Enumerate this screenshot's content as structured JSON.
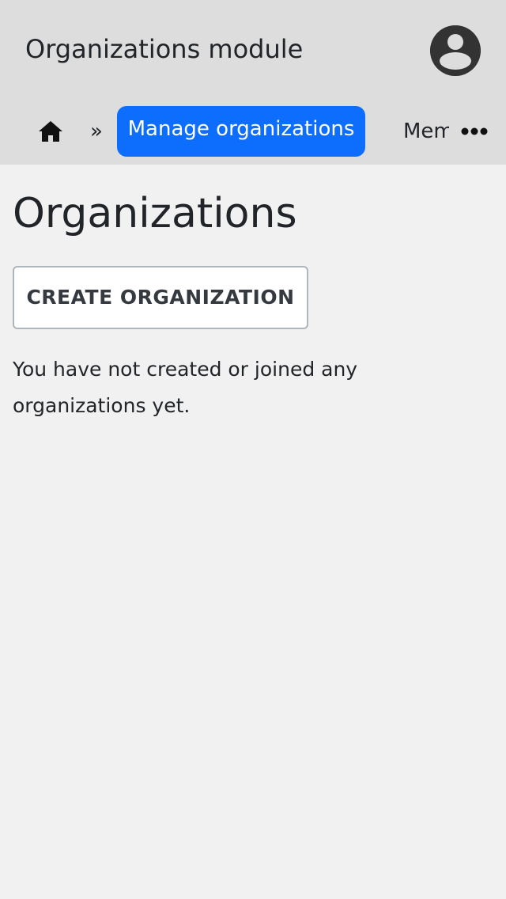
{
  "header": {
    "title": "Organizations module",
    "avatar_icon": "user-circle-icon"
  },
  "breadcrumb": {
    "home_icon": "home-icon",
    "separator": "»",
    "active_label": "Manage organizations",
    "next_label": "Members",
    "more_icon": "ellipsis-icon"
  },
  "main": {
    "title": "Organizations",
    "create_button_label": "CREATE ORGANIZATION",
    "empty_message": "You have not created or joined any organizations yet."
  },
  "colors": {
    "header_bg": "#dddddd",
    "page_bg": "#f1f1f1",
    "accent": "#0d6efd",
    "avatar": "#333333"
  }
}
